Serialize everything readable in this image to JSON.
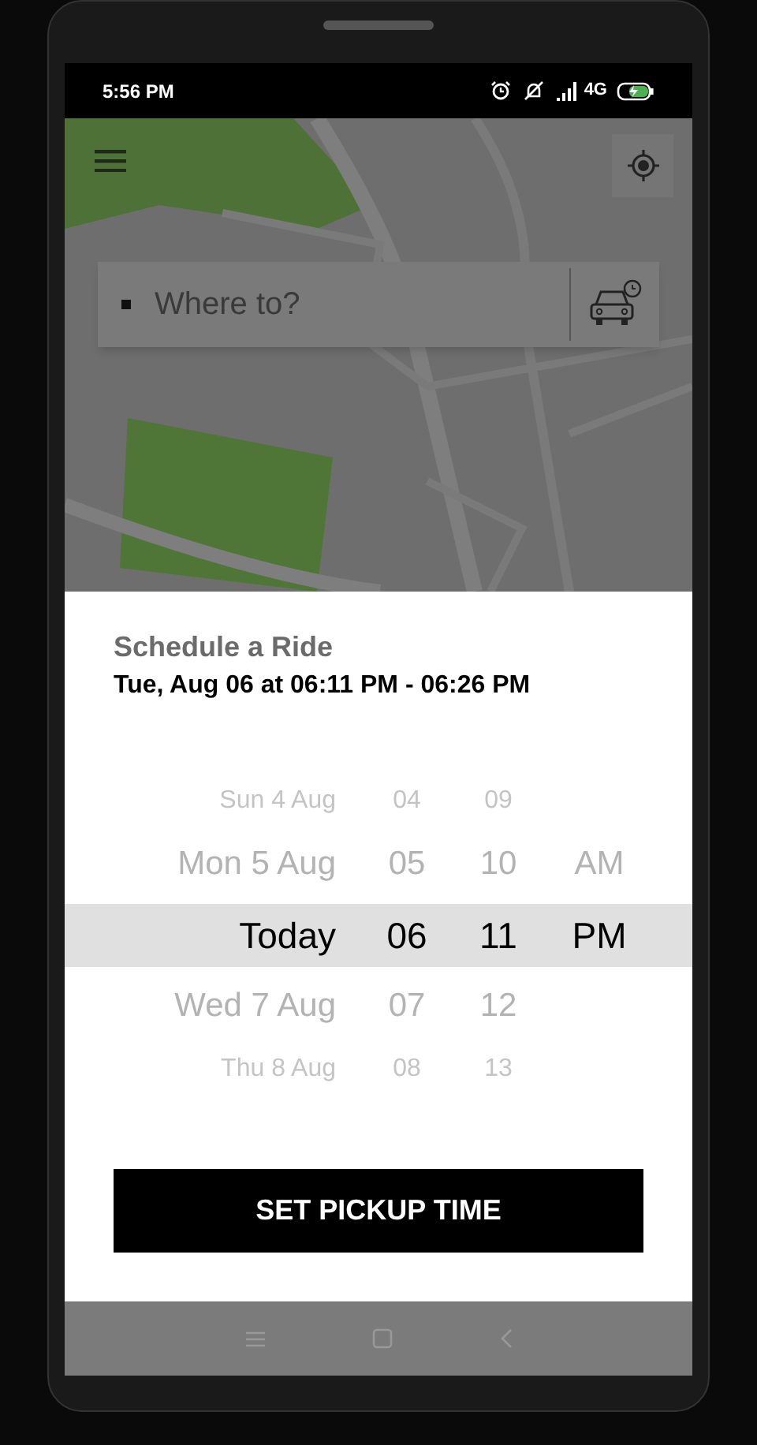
{
  "status_bar": {
    "time": "5:56 PM",
    "network": "4G"
  },
  "search": {
    "placeholder": "Where to?"
  },
  "schedule": {
    "title": "Schedule a Ride",
    "summary": "Tue, Aug 06 at 06:11 PM - 06:26 PM"
  },
  "picker": {
    "rows": [
      {
        "kind": "far",
        "selected": false,
        "day": "Sun 4 Aug",
        "hour": "04",
        "minute": "09"
      },
      {
        "kind": "near",
        "selected": false,
        "day": "Mon 5 Aug",
        "hour": "05",
        "minute": "10",
        "period": "AM"
      },
      {
        "kind": "center",
        "selected": true,
        "day": "Today",
        "hour": "06",
        "minute": "11",
        "period": "PM"
      },
      {
        "kind": "near",
        "selected": false,
        "day": "Wed 7 Aug",
        "hour": "07",
        "minute": "12"
      },
      {
        "kind": "far",
        "selected": false,
        "day": "Thu 8 Aug",
        "hour": "08",
        "minute": "13"
      }
    ]
  },
  "button": {
    "label": "SET PICKUP TIME"
  }
}
